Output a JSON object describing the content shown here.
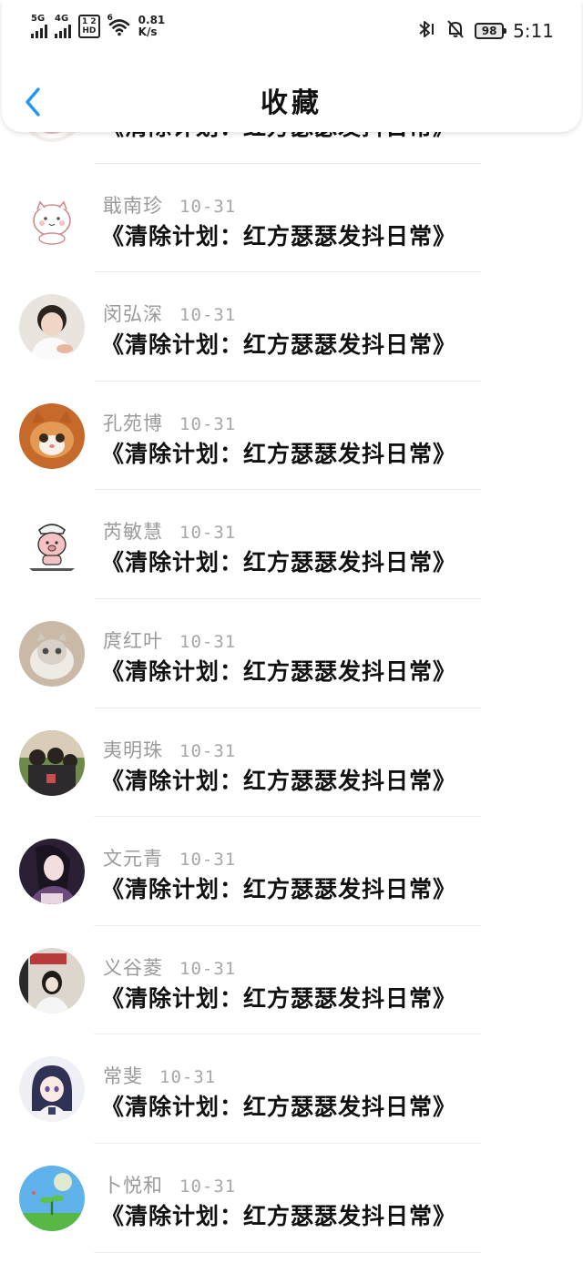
{
  "status_bar": {
    "sig1_label": "5G",
    "sig2_label": "4G",
    "hd_top": "1 2",
    "hd_bottom": "HD",
    "wifi_tag": "6",
    "speed_value": "0.81",
    "speed_unit": "K/s",
    "battery": "98",
    "time": "5:11"
  },
  "header": {
    "title": "收藏"
  },
  "favorites": [
    {
      "name": "",
      "date": "",
      "title": "《清除计划：红方瑟瑟发抖日常》"
    },
    {
      "name": "戢南珍",
      "date": "10-31",
      "title": "《清除计划：红方瑟瑟发抖日常》"
    },
    {
      "name": "闵弘深",
      "date": "10-31",
      "title": "《清除计划：红方瑟瑟发抖日常》"
    },
    {
      "name": "孔苑博",
      "date": "10-31",
      "title": "《清除计划：红方瑟瑟发抖日常》"
    },
    {
      "name": "芮敏慧",
      "date": "10-31",
      "title": "《清除计划：红方瑟瑟发抖日常》"
    },
    {
      "name": "庹红叶",
      "date": "10-31",
      "title": "《清除计划：红方瑟瑟发抖日常》"
    },
    {
      "name": "夷明珠",
      "date": "10-31",
      "title": "《清除计划：红方瑟瑟发抖日常》"
    },
    {
      "name": "文元青",
      "date": "10-31",
      "title": "《清除计划：红方瑟瑟发抖日常》"
    },
    {
      "name": "义谷菱",
      "date": "10-31",
      "title": "《清除计划：红方瑟瑟发抖日常》"
    },
    {
      "name": "常斐",
      "date": "10-31",
      "title": "《清除计划：红方瑟瑟发抖日常》"
    },
    {
      "name": "卜悦和",
      "date": "10-31",
      "title": "《清除计划：红方瑟瑟发抖日常》"
    }
  ],
  "icons": {
    "back": "chevron-left-icon",
    "bluetooth": "bluetooth-icon",
    "silent": "bell-off-icon",
    "wifi": "wifi-icon"
  },
  "colors": {
    "accent": "#2196f3",
    "muted_text": "#9a9a9a"
  }
}
